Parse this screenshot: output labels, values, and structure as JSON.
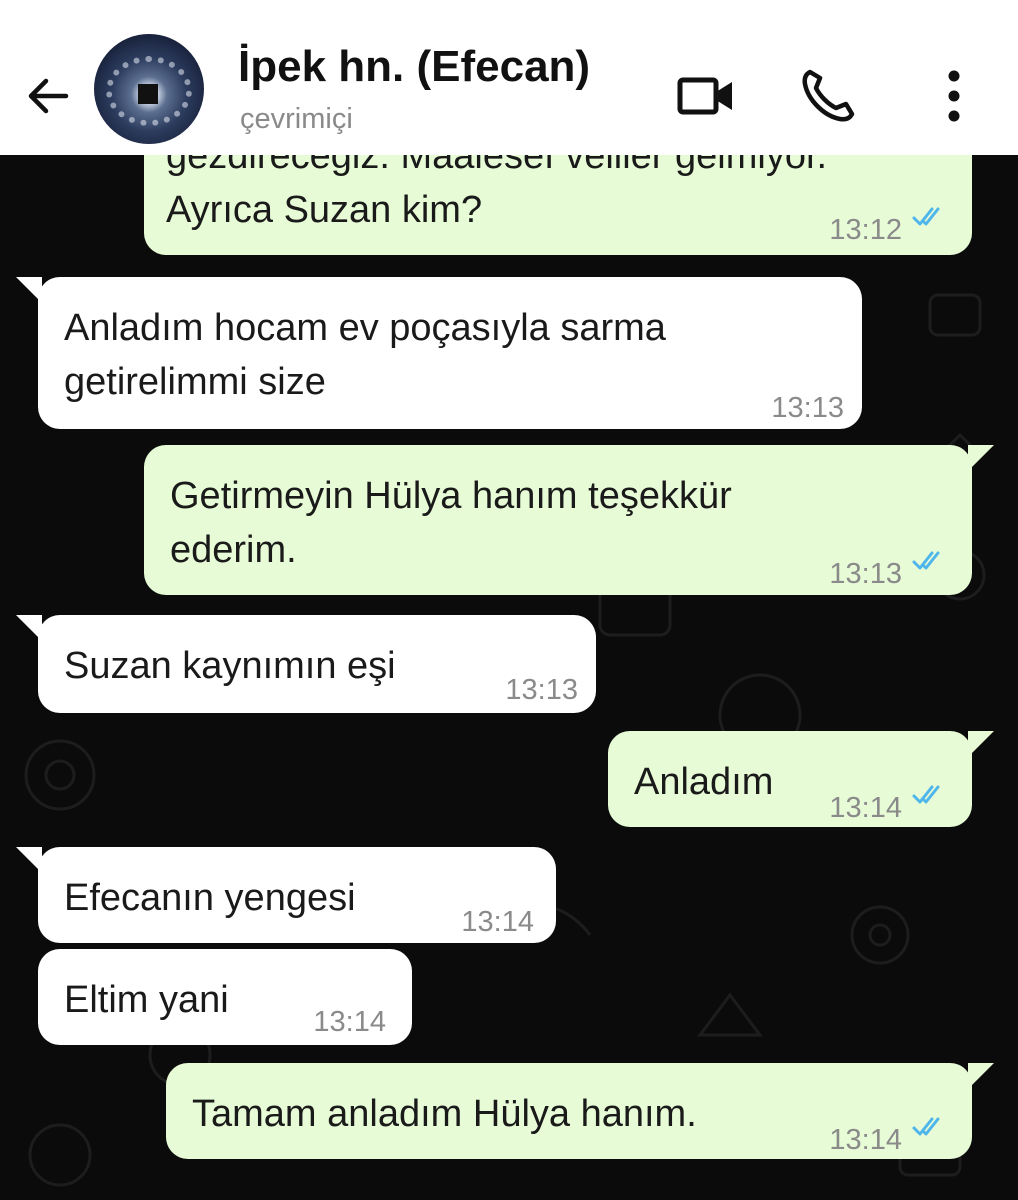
{
  "header": {
    "contact_name": "İpek hn. (Efecan)",
    "status": "çevrimiçi",
    "icons": [
      "back-arrow-icon",
      "avatar",
      "video-call-icon",
      "phone-icon",
      "more-vert-icon"
    ]
  },
  "messages": [
    {
      "direction": "out",
      "lines": [
        "gezdireceğiz. Maalesef veliler gelmiyor.",
        "Ayrıca Suzan kim?"
      ],
      "time": "13:12",
      "read": true
    },
    {
      "direction": "in",
      "lines": [
        "Anladım hocam ev poçasıyla sarma",
        "getirelimmi size"
      ],
      "time": "13:13"
    },
    {
      "direction": "out",
      "lines": [
        "Getirmeyin Hülya hanım teşekkür",
        "ederim."
      ],
      "time": "13:13",
      "read": true
    },
    {
      "direction": "in",
      "lines": [
        "Suzan kaynımın eşi"
      ],
      "time": "13:13"
    },
    {
      "direction": "out",
      "lines": [
        "Anladım"
      ],
      "time": "13:14",
      "read": true
    },
    {
      "direction": "in",
      "lines": [
        "Efecanın yengesi"
      ],
      "time": "13:14"
    },
    {
      "direction": "in",
      "lines": [
        "Eltim yani"
      ],
      "time": "13:14"
    },
    {
      "direction": "out",
      "lines": [
        "Tamam anladım Hülya hanım."
      ],
      "time": "13:14",
      "read": true
    }
  ],
  "colors": {
    "header_bg": "#ffffff",
    "chat_bg": "#0b0b0b",
    "outgoing_bubble": "#e7fcd6",
    "incoming_bubble": "#ffffff",
    "read_ticks": "#4fb6ec",
    "timestamp": "#8a8a8a"
  }
}
